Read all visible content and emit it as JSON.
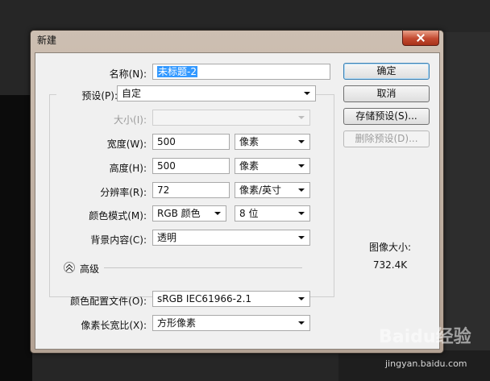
{
  "dialog": {
    "title": "新建"
  },
  "fields": {
    "name": {
      "label": "名称(N):",
      "value": "未标题-2"
    },
    "preset": {
      "label": "预设(P):",
      "value": "自定"
    },
    "size": {
      "label": "大小(I):",
      "value": ""
    },
    "width": {
      "label": "宽度(W):",
      "value": "500",
      "unit": "像素"
    },
    "height": {
      "label": "高度(H):",
      "value": "500",
      "unit": "像素"
    },
    "resolution": {
      "label": "分辨率(R):",
      "value": "72",
      "unit": "像素/英寸"
    },
    "color_mode": {
      "label": "颜色模式(M):",
      "mode": "RGB 颜色",
      "depth": "8 位"
    },
    "background": {
      "label": "背景内容(C):",
      "value": "透明"
    }
  },
  "advanced": {
    "label": "高级",
    "color_profile": {
      "label": "颜色配置文件(O):",
      "value": "sRGB IEC61966-2.1"
    },
    "pixel_aspect": {
      "label": "像素长宽比(X):",
      "value": "方形像素"
    }
  },
  "buttons": {
    "ok": "确定",
    "cancel": "取消",
    "save_preset": "存储预设(S)...",
    "delete_preset": "删除预设(D)..."
  },
  "image_size": {
    "label": "图像大小:",
    "value": "732.4K"
  },
  "watermark": {
    "logo": "Baidu经验",
    "url": "jingyan.baidu.com"
  }
}
